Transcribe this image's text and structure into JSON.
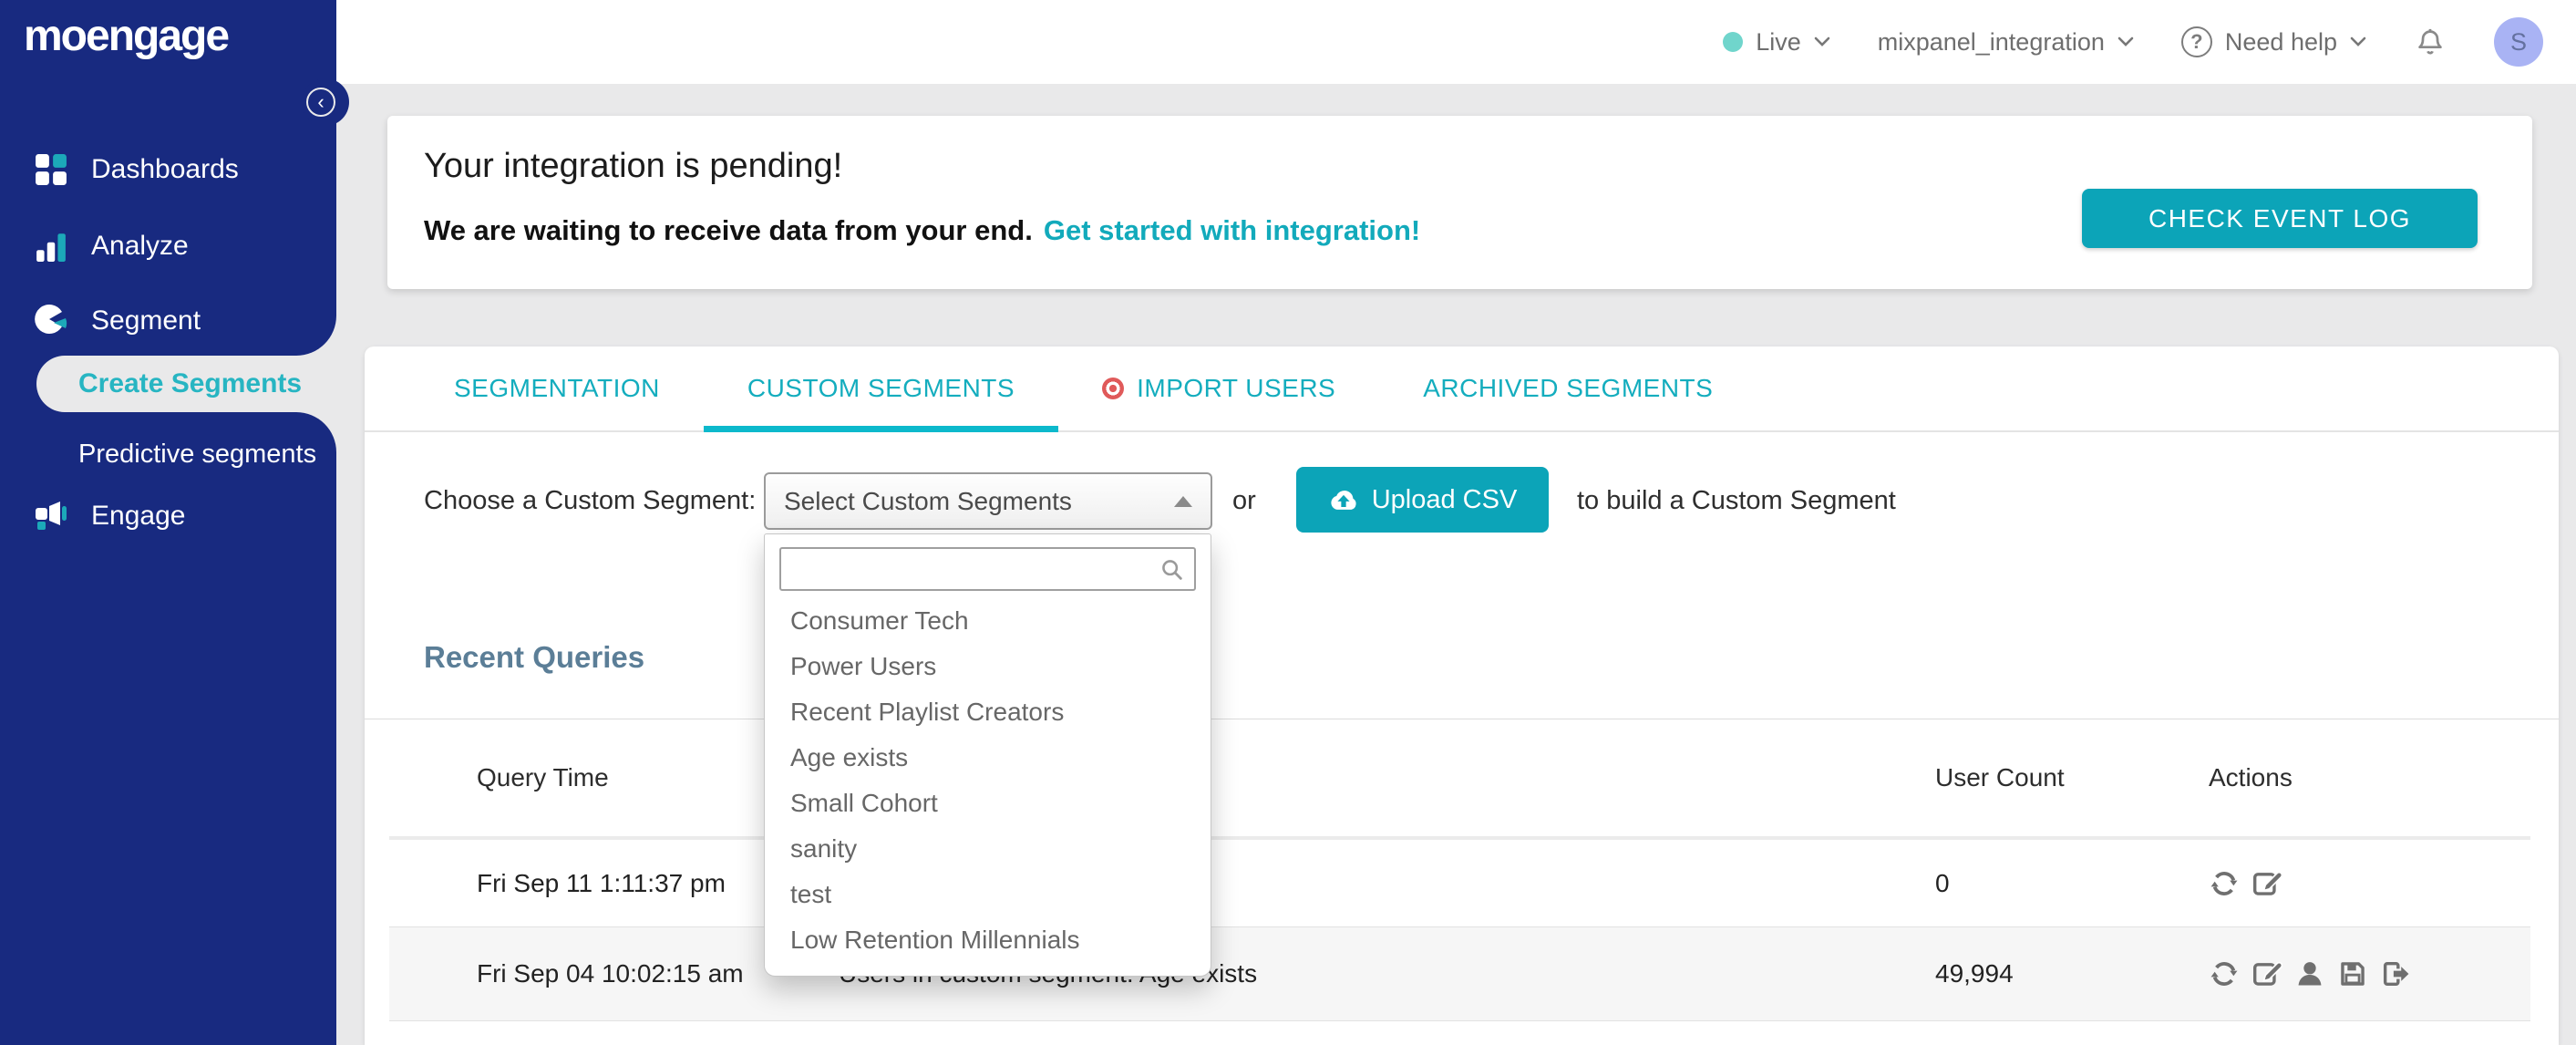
{
  "brand": {
    "logo_text": "moengage",
    "collapse_icon": "chevron-left-circle"
  },
  "colors": {
    "sidebar_navy": "#182a80",
    "accent_teal": "#0ca4b8",
    "tab_teal": "#14adbe",
    "active_underline": "#0cb9cc",
    "live_dot": "#70d5cc",
    "avatar_bg": "#a9b3f4",
    "import_badge_red": "#e05a5a",
    "heading_slate": "#5b7e97"
  },
  "topbar": {
    "environment": "Live",
    "workspace": "mixpanel_integration",
    "help_label": "Need help",
    "avatar_initial": "S",
    "icons": [
      "live-dot",
      "chevron-down",
      "question-circle",
      "bell"
    ]
  },
  "sidebar": {
    "items": [
      {
        "label": "Dashboards",
        "icon": "grid-icon"
      },
      {
        "label": "Analyze",
        "icon": "bar-chart-icon"
      },
      {
        "label": "Segment",
        "icon": "pie-chart-icon"
      },
      {
        "label": "Engage",
        "icon": "megaphone-icon"
      }
    ],
    "segment_children": [
      {
        "label": "Create Segments",
        "active": true
      },
      {
        "label": "Predictive segments",
        "active": false
      }
    ]
  },
  "banner": {
    "title": "Your integration is pending!",
    "subtitle": "We are waiting to receive data from your end.",
    "link_label": "Get started with integration!",
    "button_label": "CHECK EVENT LOG"
  },
  "tabs": [
    {
      "label": "SEGMENTATION",
      "active": false
    },
    {
      "label": "CUSTOM SEGMENTS",
      "active": true
    },
    {
      "label": "IMPORT USERS",
      "active": false,
      "badge_icon": "red-ring-dot"
    },
    {
      "label": "ARCHIVED SEGMENTS",
      "active": false
    }
  ],
  "chooser": {
    "label": "Choose a Custom Segment:",
    "select_value": "Select Custom Segments",
    "or_text": "or",
    "upload_button_label": "Upload CSV",
    "upload_button_icon": "cloud-upload",
    "suffix_text": "to build a Custom Segment"
  },
  "dropdown": {
    "search_placeholder": "",
    "search_icon": "magnifier",
    "options": [
      "Consumer Tech",
      "Power Users",
      "Recent Playlist Creators",
      "Age exists",
      "Small Cohort",
      "sanity",
      "test",
      "Low Retention Millennials"
    ]
  },
  "recent_queries": {
    "title": "Recent Queries",
    "columns": [
      "Query Time",
      "User Count",
      "Actions"
    ],
    "rows": [
      {
        "query_time": "Fri Sep 11 1:11:37 pm",
        "description": "",
        "user_count": "0",
        "actions": [
          "refresh",
          "edit"
        ]
      },
      {
        "query_time": "Fri Sep 04 10:02:15 am",
        "description": "Users in custom segment: Age exists",
        "user_count": "49,994",
        "actions": [
          "refresh",
          "edit",
          "user",
          "save",
          "export"
        ]
      }
    ]
  }
}
